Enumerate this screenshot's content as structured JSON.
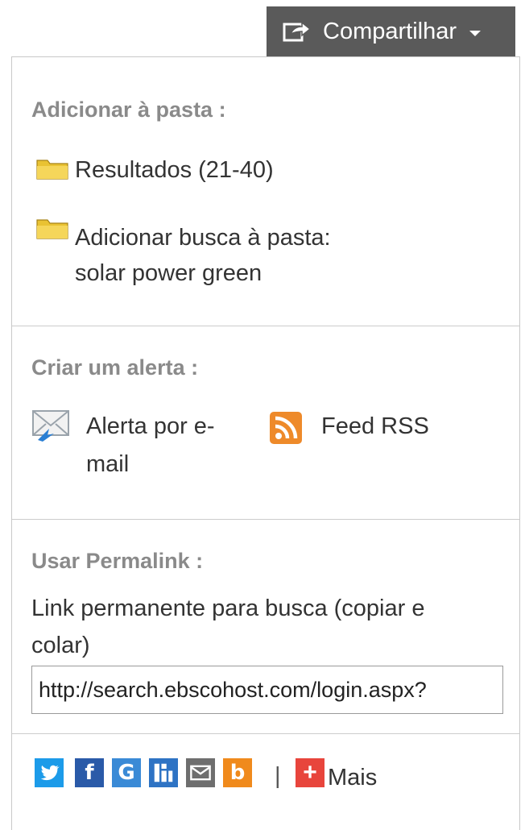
{
  "share_button": {
    "label": "Compartilhar",
    "icon": "share-arrow-icon"
  },
  "folder_section": {
    "title": "Adicionar à pasta :",
    "results_link": "Resultados (21-40)",
    "add_search_label": "Adicionar busca à pasta:",
    "search_term_link": "solar power green"
  },
  "alert_section": {
    "title": "Criar um alerta :",
    "email_alert_line1": "Alerta por e-",
    "email_alert_line2": "mail",
    "rss_label": "Feed RSS"
  },
  "permalink_section": {
    "title": "Usar Permalink :",
    "description_line1": "Link permanente para busca (copiar e",
    "description_line2": "colar)",
    "url_value": "http://search.ebscohost.com/login.aspx?"
  },
  "social": {
    "separator": "|",
    "more_label": "Mais",
    "colors": {
      "twitter": "#1c9be9",
      "facebook": "#2a5aa8",
      "google": "#3a8ad6",
      "delicious": "#2e73c4",
      "email": "#6e6e6e",
      "blogger": "#f08a1c",
      "more": "#e8453c"
    }
  }
}
